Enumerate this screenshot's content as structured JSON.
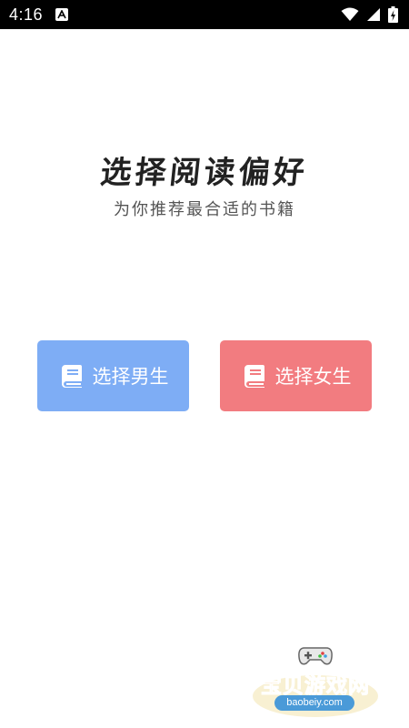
{
  "status_bar": {
    "time": "4:16",
    "icons": [
      "notification-a-icon",
      "wifi-icon",
      "signal-icon",
      "battery-icon"
    ]
  },
  "header": {
    "title": "选择阅读偏好",
    "subtitle": "为你推荐最合适的书籍"
  },
  "choices": [
    {
      "label": "选择男生",
      "icon": "book-icon",
      "color": "#7eadf5"
    },
    {
      "label": "选择女生",
      "icon": "book-icon",
      "color": "#f27c80"
    }
  ],
  "watermark": {
    "name": "宝贝游戏网",
    "url": "baobeiy.com",
    "icon": "gamepad-icon",
    "color": "#f0a020"
  }
}
